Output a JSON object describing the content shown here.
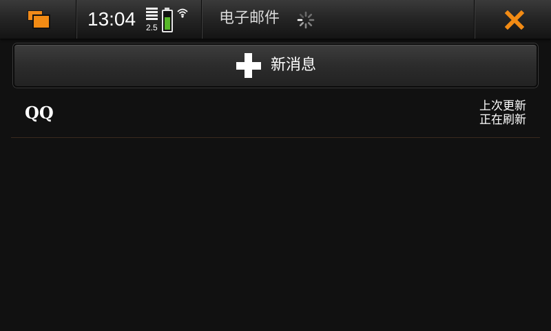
{
  "statusbar": {
    "time": "13:04",
    "network_label": "2.5",
    "battery_level": 0.7,
    "title": "电子邮件",
    "icons": {
      "switcher": "task-switcher-icon",
      "signal": "signal-strength-icon",
      "battery": "battery-icon",
      "wifi": "wifi-icon",
      "spinner": "loading-spinner-icon",
      "close": "close-icon"
    }
  },
  "new_message": {
    "label": "新消息",
    "icon": "plus-icon"
  },
  "accounts": [
    {
      "name": "QQ",
      "status_line1": "上次更新",
      "status_line2": "正在刷新"
    }
  ],
  "colors": {
    "accent": "#f28b14",
    "battery_fill": "#58b82a",
    "background": "#111111"
  }
}
